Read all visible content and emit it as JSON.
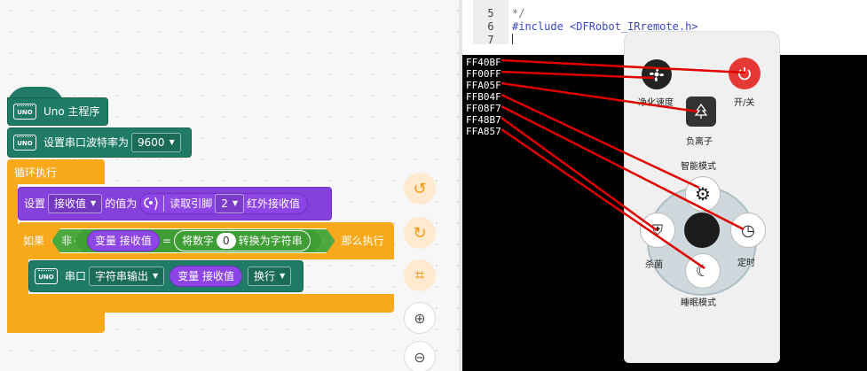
{
  "blocks": {
    "main_label": "Uno 主程序",
    "serial_baud_label": "设置串口波特率为",
    "baud_value": "9600",
    "loop_label": "循环执行",
    "set_label": "设置",
    "variable_name": "接收值",
    "value_is_label": "的值为",
    "read_pin_label": "读取引脚",
    "pin_value": "2",
    "ir_receive_label": "红外接收值",
    "if_label": "如果",
    "not_label": "非",
    "var_label": "变量",
    "var_name": "接收值",
    "equals": "=",
    "convert_label": "将数字",
    "convert_number": "0",
    "to_string_label": "转换为字符串",
    "then_label": "那么执行",
    "serial_label": "串口",
    "string_output": "字符串输出",
    "newline": "换行",
    "uno_chip_text": "UNO"
  },
  "code": {
    "lines": [
      {
        "n": "5",
        "text": "*/"
      },
      {
        "n": "6",
        "text": "#include <DFRobot_IRremote.h>"
      },
      {
        "n": "7",
        "text": ""
      }
    ]
  },
  "serial_output": [
    "FF40BF",
    "FF00FF",
    "FFA05F",
    "FFB04F",
    "FF08F7",
    "FF48B7",
    "FFA857"
  ],
  "remote": {
    "btn_purify": "净化速度",
    "btn_power": "开/关",
    "btn_ion": "负离子",
    "btn_smart": "智能模式",
    "btn_sterilize": "杀菌",
    "btn_timer": "定时",
    "btn_sleep": "睡眠模式"
  },
  "colors": {
    "teal": "#1f7a66",
    "orange": "#f7a81b",
    "purple": "#8640dc",
    "green": "#55b348",
    "arrow": "#e00000",
    "power_red": "#e53935"
  }
}
